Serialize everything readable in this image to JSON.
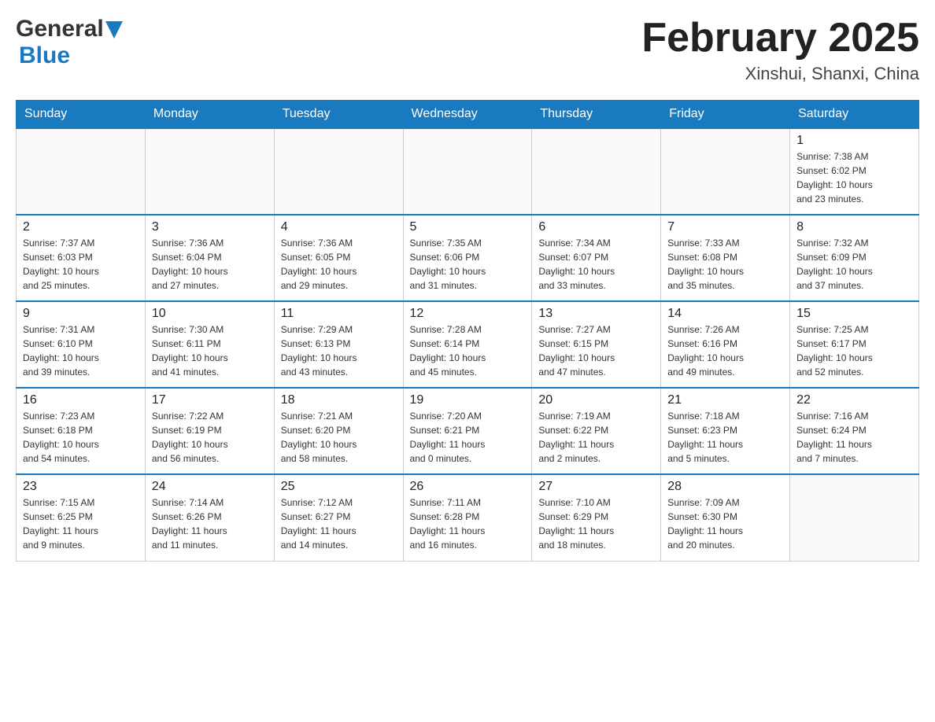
{
  "logo": {
    "general": "General",
    "blue": "Blue"
  },
  "title": "February 2025",
  "subtitle": "Xinshui, Shanxi, China",
  "days_of_week": [
    "Sunday",
    "Monday",
    "Tuesday",
    "Wednesday",
    "Thursday",
    "Friday",
    "Saturday"
  ],
  "weeks": [
    {
      "days": [
        {
          "number": "",
          "info": ""
        },
        {
          "number": "",
          "info": ""
        },
        {
          "number": "",
          "info": ""
        },
        {
          "number": "",
          "info": ""
        },
        {
          "number": "",
          "info": ""
        },
        {
          "number": "",
          "info": ""
        },
        {
          "number": "1",
          "info": "Sunrise: 7:38 AM\nSunset: 6:02 PM\nDaylight: 10 hours\nand 23 minutes."
        }
      ]
    },
    {
      "days": [
        {
          "number": "2",
          "info": "Sunrise: 7:37 AM\nSunset: 6:03 PM\nDaylight: 10 hours\nand 25 minutes."
        },
        {
          "number": "3",
          "info": "Sunrise: 7:36 AM\nSunset: 6:04 PM\nDaylight: 10 hours\nand 27 minutes."
        },
        {
          "number": "4",
          "info": "Sunrise: 7:36 AM\nSunset: 6:05 PM\nDaylight: 10 hours\nand 29 minutes."
        },
        {
          "number": "5",
          "info": "Sunrise: 7:35 AM\nSunset: 6:06 PM\nDaylight: 10 hours\nand 31 minutes."
        },
        {
          "number": "6",
          "info": "Sunrise: 7:34 AM\nSunset: 6:07 PM\nDaylight: 10 hours\nand 33 minutes."
        },
        {
          "number": "7",
          "info": "Sunrise: 7:33 AM\nSunset: 6:08 PM\nDaylight: 10 hours\nand 35 minutes."
        },
        {
          "number": "8",
          "info": "Sunrise: 7:32 AM\nSunset: 6:09 PM\nDaylight: 10 hours\nand 37 minutes."
        }
      ]
    },
    {
      "days": [
        {
          "number": "9",
          "info": "Sunrise: 7:31 AM\nSunset: 6:10 PM\nDaylight: 10 hours\nand 39 minutes."
        },
        {
          "number": "10",
          "info": "Sunrise: 7:30 AM\nSunset: 6:11 PM\nDaylight: 10 hours\nand 41 minutes."
        },
        {
          "number": "11",
          "info": "Sunrise: 7:29 AM\nSunset: 6:13 PM\nDaylight: 10 hours\nand 43 minutes."
        },
        {
          "number": "12",
          "info": "Sunrise: 7:28 AM\nSunset: 6:14 PM\nDaylight: 10 hours\nand 45 minutes."
        },
        {
          "number": "13",
          "info": "Sunrise: 7:27 AM\nSunset: 6:15 PM\nDaylight: 10 hours\nand 47 minutes."
        },
        {
          "number": "14",
          "info": "Sunrise: 7:26 AM\nSunset: 6:16 PM\nDaylight: 10 hours\nand 49 minutes."
        },
        {
          "number": "15",
          "info": "Sunrise: 7:25 AM\nSunset: 6:17 PM\nDaylight: 10 hours\nand 52 minutes."
        }
      ]
    },
    {
      "days": [
        {
          "number": "16",
          "info": "Sunrise: 7:23 AM\nSunset: 6:18 PM\nDaylight: 10 hours\nand 54 minutes."
        },
        {
          "number": "17",
          "info": "Sunrise: 7:22 AM\nSunset: 6:19 PM\nDaylight: 10 hours\nand 56 minutes."
        },
        {
          "number": "18",
          "info": "Sunrise: 7:21 AM\nSunset: 6:20 PM\nDaylight: 10 hours\nand 58 minutes."
        },
        {
          "number": "19",
          "info": "Sunrise: 7:20 AM\nSunset: 6:21 PM\nDaylight: 11 hours\nand 0 minutes."
        },
        {
          "number": "20",
          "info": "Sunrise: 7:19 AM\nSunset: 6:22 PM\nDaylight: 11 hours\nand 2 minutes."
        },
        {
          "number": "21",
          "info": "Sunrise: 7:18 AM\nSunset: 6:23 PM\nDaylight: 11 hours\nand 5 minutes."
        },
        {
          "number": "22",
          "info": "Sunrise: 7:16 AM\nSunset: 6:24 PM\nDaylight: 11 hours\nand 7 minutes."
        }
      ]
    },
    {
      "days": [
        {
          "number": "23",
          "info": "Sunrise: 7:15 AM\nSunset: 6:25 PM\nDaylight: 11 hours\nand 9 minutes."
        },
        {
          "number": "24",
          "info": "Sunrise: 7:14 AM\nSunset: 6:26 PM\nDaylight: 11 hours\nand 11 minutes."
        },
        {
          "number": "25",
          "info": "Sunrise: 7:12 AM\nSunset: 6:27 PM\nDaylight: 11 hours\nand 14 minutes."
        },
        {
          "number": "26",
          "info": "Sunrise: 7:11 AM\nSunset: 6:28 PM\nDaylight: 11 hours\nand 16 minutes."
        },
        {
          "number": "27",
          "info": "Sunrise: 7:10 AM\nSunset: 6:29 PM\nDaylight: 11 hours\nand 18 minutes."
        },
        {
          "number": "28",
          "info": "Sunrise: 7:09 AM\nSunset: 6:30 PM\nDaylight: 11 hours\nand 20 minutes."
        },
        {
          "number": "",
          "info": ""
        }
      ]
    }
  ]
}
